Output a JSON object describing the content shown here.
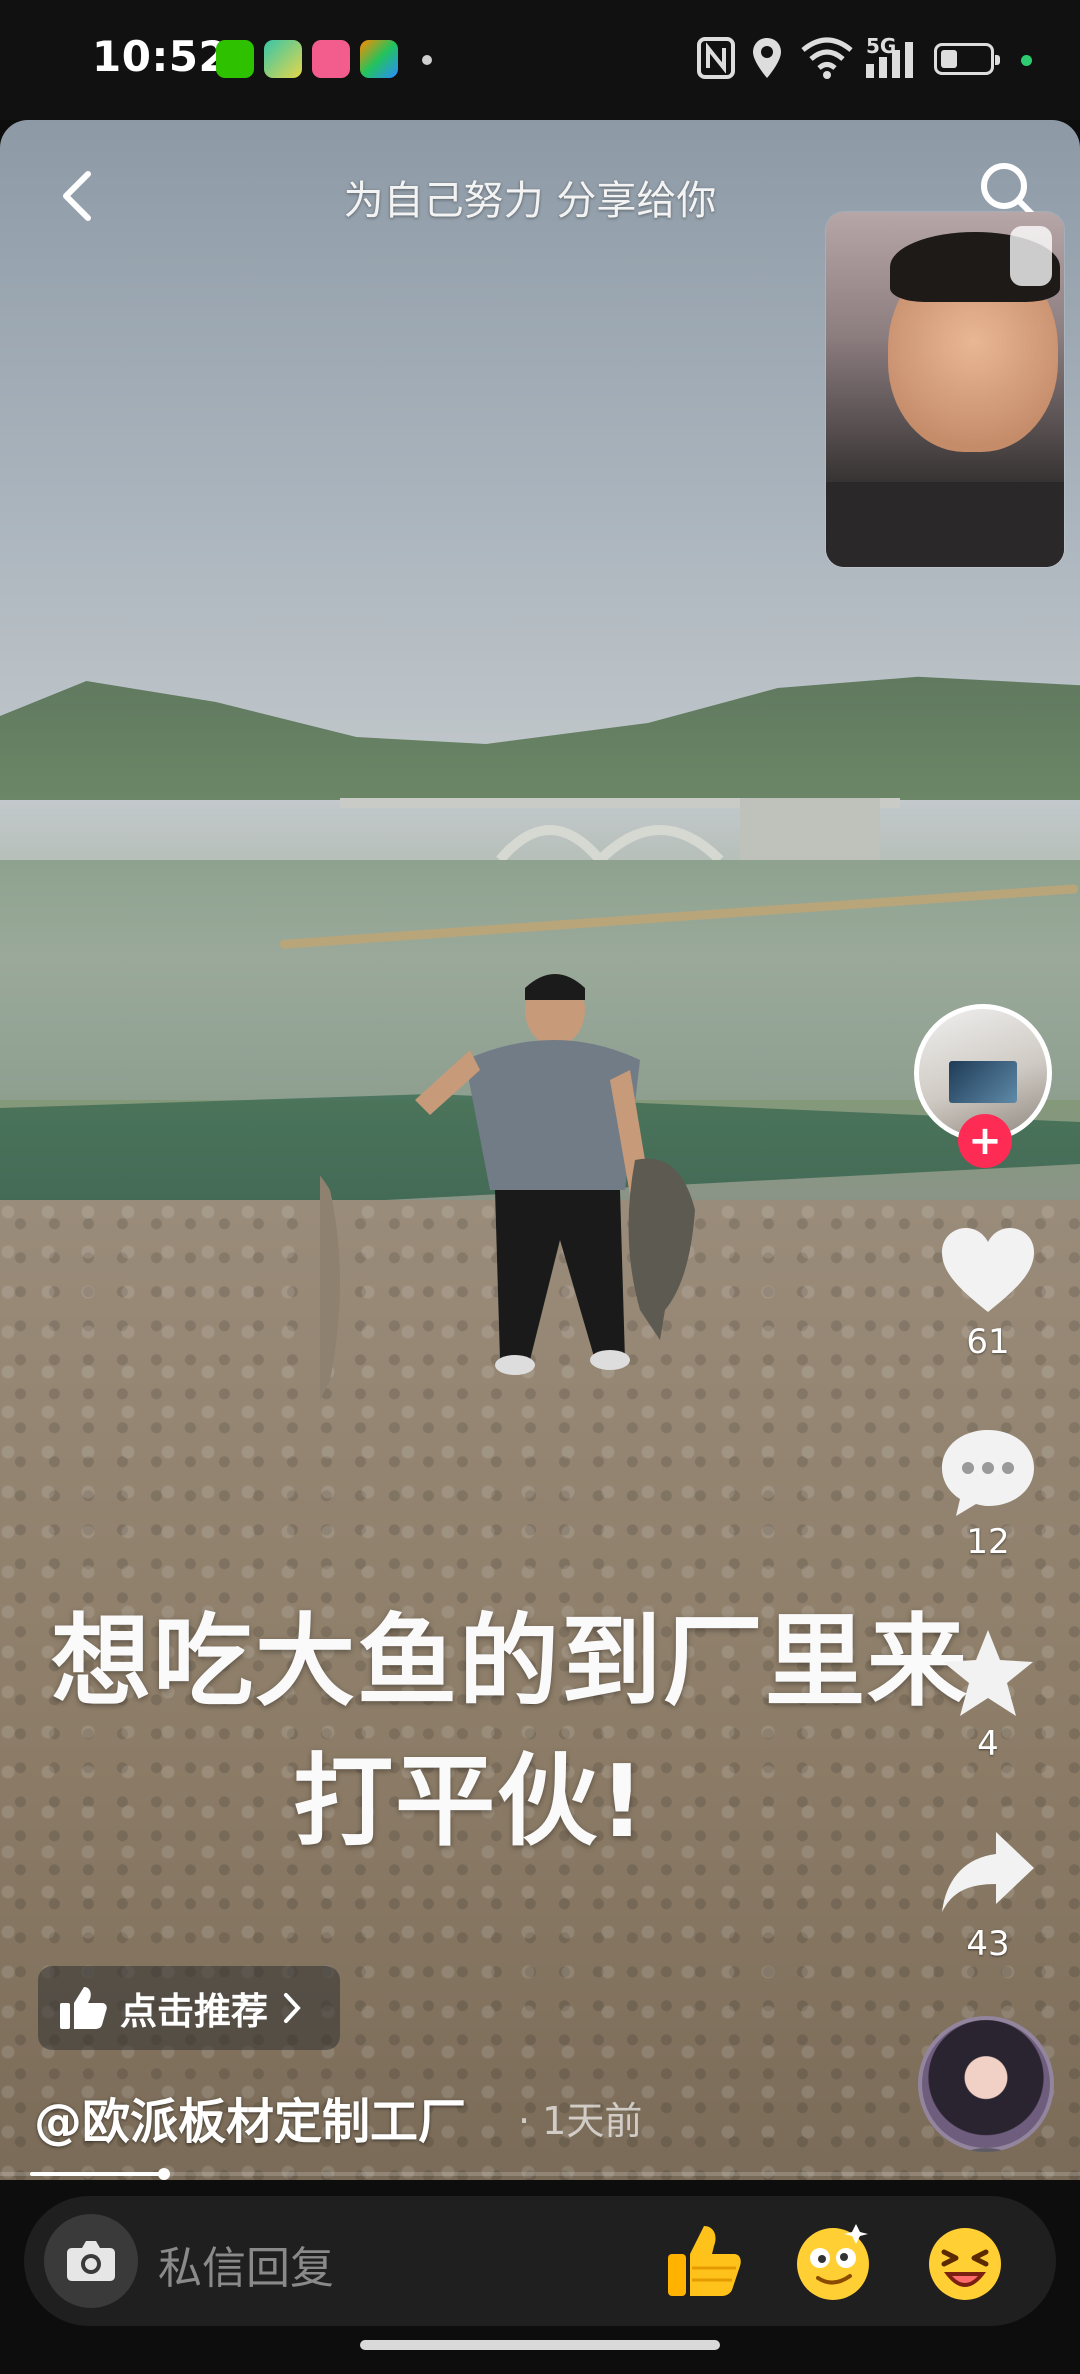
{
  "status_bar": {
    "time": "10:52",
    "network": "5G",
    "apps": [
      "wechat-icon",
      "network-app-icon",
      "bilibili-icon",
      "video-app-icon"
    ]
  },
  "header": {
    "title": "为自己努力 分享给你"
  },
  "video": {
    "caption_line1": "想吃大鱼的到厂里来",
    "caption_line2": "打平伙!"
  },
  "actions": {
    "likes": "61",
    "comments": "12",
    "favorites": "4",
    "shares": "43"
  },
  "recommend": {
    "label": "点击推荐"
  },
  "author": {
    "handle": "@欧派板材定制工厂",
    "time_ago": "· 1天前"
  },
  "reply": {
    "placeholder": "私信回复"
  },
  "colors": {
    "accent": "#fe2c55",
    "thumb": "#ffb300",
    "bar": "#1f1f1f"
  }
}
